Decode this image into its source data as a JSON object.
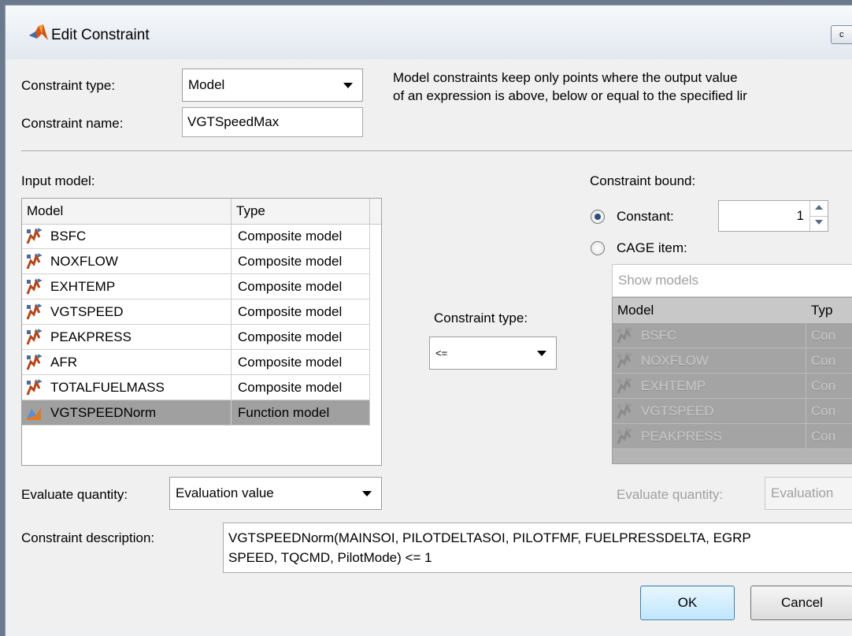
{
  "window": {
    "title": "Edit Constraint",
    "title_button_label": "c"
  },
  "header": {
    "constraint_type_label": "Constraint type:",
    "constraint_type_value": "Model",
    "constraint_name_label": "Constraint name:",
    "constraint_name_value": "VGTSpeedMax",
    "description_line1": "Model constraints keep only points where the output value",
    "description_line2": "of an expression is above, below or equal to the specified lir"
  },
  "input_model": {
    "label": "Input model:",
    "columns": [
      "Model",
      "Type"
    ],
    "rows": [
      {
        "model": "BSFC",
        "type": "Composite model",
        "icon": "composite-model-icon"
      },
      {
        "model": "NOXFLOW",
        "type": "Composite model",
        "icon": "composite-model-icon"
      },
      {
        "model": "EXHTEMP",
        "type": "Composite model",
        "icon": "composite-model-icon"
      },
      {
        "model": "VGTSPEED",
        "type": "Composite model",
        "icon": "composite-model-icon"
      },
      {
        "model": "PEAKPRESS",
        "type": "Composite model",
        "icon": "composite-model-icon"
      },
      {
        "model": "AFR",
        "type": "Composite model",
        "icon": "composite-model-icon"
      },
      {
        "model": "TOTALFUELMASS",
        "type": "Composite model",
        "icon": "composite-model-icon"
      },
      {
        "model": "VGTSPEEDNorm",
        "type": "Function model",
        "icon": "function-model-icon",
        "selected": true
      }
    ],
    "evaluate_label": "Evaluate quantity:",
    "evaluate_value": "Evaluation value"
  },
  "middle": {
    "constraint_type_label": "Constraint type:",
    "operator_value": "<="
  },
  "bound": {
    "label": "Constraint bound:",
    "constant_label": "Constant:",
    "constant_value": "1",
    "constant_selected": true,
    "cage_label": "CAGE item:",
    "show_models_value": "Show models",
    "columns": [
      "Model",
      "Typ"
    ],
    "rows": [
      {
        "model": "BSFC",
        "type": "Con"
      },
      {
        "model": "NOXFLOW",
        "type": "Con"
      },
      {
        "model": "EXHTEMP",
        "type": "Con"
      },
      {
        "model": "VGTSPEED",
        "type": "Con"
      },
      {
        "model": "PEAKPRESS",
        "type": "Con"
      }
    ],
    "evaluate_label": "Evaluate quantity:",
    "evaluate_value": "Evaluation"
  },
  "description": {
    "label": "Constraint description:",
    "line1": "VGTSPEEDNorm(MAINSOI, PILOTDELTASOI, PILOTFMF, FUELPRESSDELTA, EGRP",
    "line2": "SPEED, TQCMD, PilotMode) <= 1"
  },
  "buttons": {
    "ok": "OK",
    "cancel": "Cancel"
  }
}
